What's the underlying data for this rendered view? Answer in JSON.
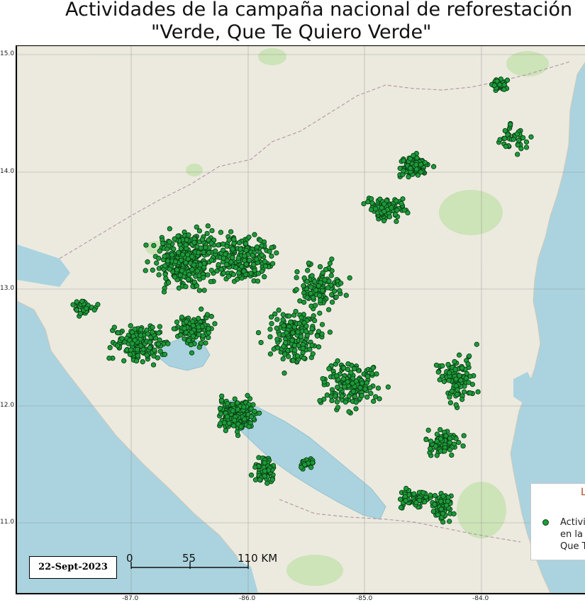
{
  "map": {
    "title_line1": "Actividades de la campaña nacional de reforestación",
    "title_line2": "\"Verde, Que Te Quiero Verde\"",
    "date_label": "22-Sept-2023",
    "scale_labels": [
      "0",
      "55",
      "110 KM"
    ],
    "lat_labels": [
      "15.0",
      "14.0",
      "13.0",
      "12.0",
      "11.0"
    ],
    "lon_labels": [
      "-87.0",
      "-86.0",
      "-85.0",
      "-84.0"
    ],
    "legend": {
      "title": "L",
      "lines": [
        "Activi",
        "en la",
        "Que T"
      ]
    },
    "colors": {
      "land": "#eceadf",
      "water": "#aad3df",
      "point_fill": "#1d9b3a",
      "point_stroke": "#0b3d14",
      "grid": "#8a8a8a"
    }
  }
}
